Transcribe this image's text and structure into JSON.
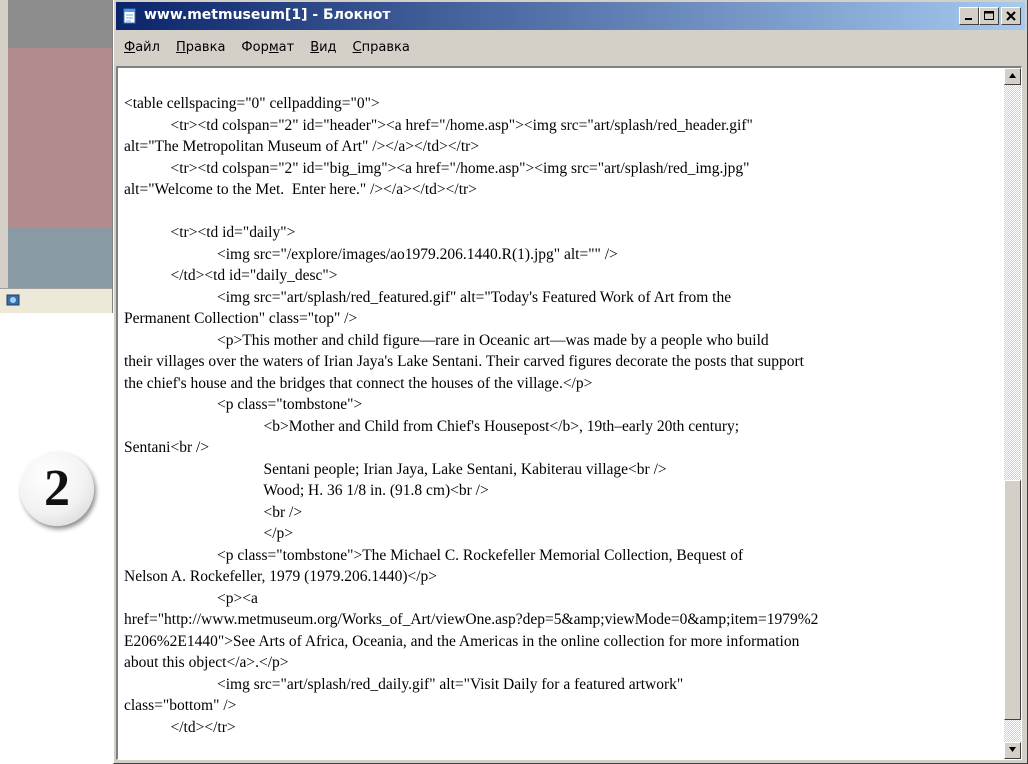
{
  "window": {
    "title": "www.metmuseum[1] - Блокнот",
    "menu": {
      "file": {
        "acc": "Ф",
        "rest": "айл"
      },
      "edit": {
        "acc": "П",
        "rest": "равка"
      },
      "format_pre": "Фор",
      "format_acc": "м",
      "format_post": "ат",
      "view": {
        "acc": "В",
        "rest": "ид"
      },
      "help": {
        "acc": "С",
        "rest": "правка"
      }
    }
  },
  "slide_number": "2",
  "editor": {
    "lines": [
      "<table cellspacing=\"0\" cellpadding=\"0\">",
      "            <tr><td colspan=\"2\" id=\"header\"><a href=\"/home.asp\"><img src=\"art/splash/red_header.gif\"",
      "alt=\"The Metropolitan Museum of Art\" /></a></td></tr>",
      "            <tr><td colspan=\"2\" id=\"big_img\"><a href=\"/home.asp\"><img src=\"art/splash/red_img.jpg\"",
      "alt=\"Welcome to the Met.  Enter here.\" /></a></td></tr>",
      "",
      "            <tr><td id=\"daily\">",
      "                        <img src=\"/explore/images/ao1979.206.1440.R(1).jpg\" alt=\"\" />",
      "            </td><td id=\"daily_desc\">",
      "                        <img src=\"art/splash/red_featured.gif\" alt=\"Today's Featured Work of Art from the",
      "Permanent Collection\" class=\"top\" />",
      "                        <p>This mother and child figure—rare in Oceanic art—was made by a people who build",
      "their villages over the waters of Irian Jaya's Lake Sentani. Their carved figures decorate the posts that support",
      "the chief's house and the bridges that connect the houses of the village.</p>",
      "                        <p class=\"tombstone\">",
      "                                    <b>Mother and Child from Chief's Housepost</b>, 19th–early 20th century;",
      "Sentani<br />",
      "                                    Sentani people; Irian Jaya, Lake Sentani, Kabiterau village<br />",
      "                                    Wood; H. 36 1/8 in. (91.8 cm)<br />",
      "                                    <br />",
      "                                    </p>",
      "                        <p class=\"tombstone\">The Michael C. Rockefeller Memorial Collection, Bequest of",
      "Nelson A. Rockefeller, 1979 (1979.206.1440)</p>",
      "                        <p><a",
      "href=\"http://www.metmuseum.org/Works_of_Art/viewOne.asp?dep=5&amp;viewMode=0&amp;item=1979%2",
      "E206%2E1440\">See Arts of Africa, Oceania, and the Americas in the online collection for more information",
      "about this object</a>.</p>",
      "                        <img src=\"art/splash/red_daily.gif\" alt=\"Visit Daily for a featured artwork\"",
      "class=\"bottom\" />",
      "            </td></tr>"
    ]
  },
  "scrollbar": {
    "position": 0.6
  }
}
